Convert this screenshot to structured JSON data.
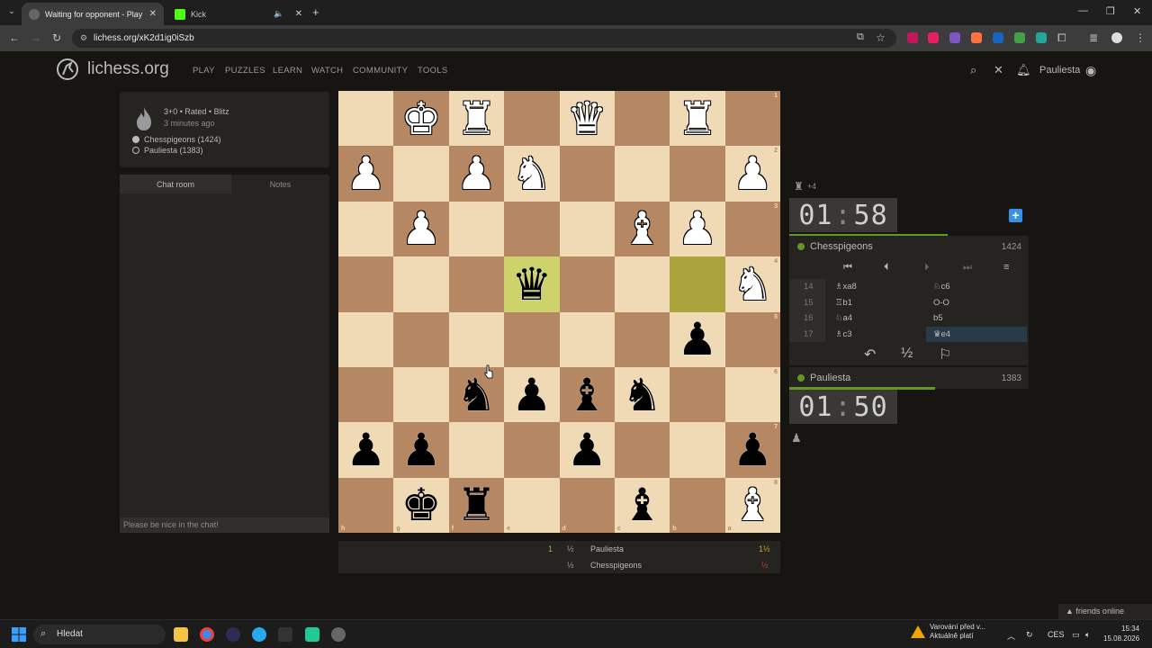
{
  "browser": {
    "tabs": [
      {
        "title": "Waiting for opponent - Play Ch",
        "close": "✕"
      },
      {
        "title": "Kick",
        "close": "✕"
      }
    ],
    "url": "lichess.org/xK2d1ig0iSzb"
  },
  "header": {
    "logo": "lichess.org",
    "nav": [
      "PLAY",
      "PUZZLES",
      "LEARN",
      "WATCH",
      "COMMUNITY",
      "TOOLS"
    ],
    "username": "Pauliesta"
  },
  "game_info": {
    "setup": "3+0 • Rated • Blitz",
    "time_ago": "3 minutes ago",
    "players": [
      "Chesspigeons (1424)",
      "Pauliesta (1383)"
    ]
  },
  "chat": {
    "tabs": [
      "Chat room",
      "Notes"
    ],
    "placeholder": "Please be nice in the chat!"
  },
  "board": {
    "orientation": "black",
    "ranks_top_to_bottom": [
      "1",
      "2",
      "3",
      "4",
      "5",
      "6",
      "7",
      "8"
    ],
    "files_left_to_right": [
      "h",
      "g",
      "f",
      "e",
      "d",
      "c",
      "b",
      "a"
    ],
    "last_move_squares": [
      "e4",
      "b4"
    ],
    "pieces": [
      {
        "sq": "g1",
        "p": "♚",
        "c": "w"
      },
      {
        "sq": "f1",
        "p": "♜",
        "c": "w"
      },
      {
        "sq": "d1",
        "p": "♛",
        "c": "w"
      },
      {
        "sq": "b1",
        "p": "♜",
        "c": "w"
      },
      {
        "sq": "h2",
        "p": "♟",
        "c": "w"
      },
      {
        "sq": "f2",
        "p": "♟",
        "c": "w"
      },
      {
        "sq": "e2",
        "p": "♞",
        "c": "w"
      },
      {
        "sq": "a2",
        "p": "♟",
        "c": "w"
      },
      {
        "sq": "g3",
        "p": "♟",
        "c": "w"
      },
      {
        "sq": "c3",
        "p": "♝",
        "c": "w"
      },
      {
        "sq": "b3",
        "p": "♟",
        "c": "w"
      },
      {
        "sq": "e4",
        "p": "♛",
        "c": "b"
      },
      {
        "sq": "a4",
        "p": "♞",
        "c": "w"
      },
      {
        "sq": "b5",
        "p": "♟",
        "c": "b"
      },
      {
        "sq": "f6",
        "p": "♞",
        "c": "b"
      },
      {
        "sq": "e6",
        "p": "♟",
        "c": "b"
      },
      {
        "sq": "d6",
        "p": "♝",
        "c": "b"
      },
      {
        "sq": "c6",
        "p": "♞",
        "c": "b"
      },
      {
        "sq": "h7",
        "p": "♟",
        "c": "b"
      },
      {
        "sq": "g7",
        "p": "♟",
        "c": "b"
      },
      {
        "sq": "d7",
        "p": "♟",
        "c": "b"
      },
      {
        "sq": "a7",
        "p": "♟",
        "c": "b"
      },
      {
        "sq": "g8",
        "p": "♚",
        "c": "b"
      },
      {
        "sq": "f8",
        "p": "♜",
        "c": "b"
      },
      {
        "sq": "c8",
        "p": "♝",
        "c": "b"
      },
      {
        "sq": "a8",
        "p": "♝",
        "c": "w"
      }
    ]
  },
  "scores": {
    "rows": [
      {
        "game": "1",
        "half": "½",
        "name": "Pauliesta",
        "score": "1½"
      },
      {
        "game": "",
        "half": "½",
        "name": "Chesspigeons",
        "score": "½"
      }
    ]
  },
  "right_panel": {
    "captured": "+4",
    "top_clock": {
      "min": "01",
      "sec": "58",
      "remaining_fraction": 0.66
    },
    "top_player": {
      "name": "Chesspigeons",
      "rating": "1424"
    },
    "moves": [
      {
        "n": "14",
        "w": "♗xa8",
        "b": "♘c6"
      },
      {
        "n": "15",
        "w": "♖b1",
        "b": "O-O"
      },
      {
        "n": "16",
        "w": "♘a4",
        "b": "b5"
      },
      {
        "n": "17",
        "w": "♗c3",
        "b": "♛e4"
      }
    ],
    "bottom_player": {
      "name": "Pauliesta",
      "rating": "1383"
    },
    "bottom_clock": {
      "min": "01",
      "sec": "50",
      "remaining_fraction": 0.61
    }
  },
  "footer": {
    "friends": "friends online"
  },
  "taskbar": {
    "search": "Hledat",
    "warning_title": "Varování před v...",
    "warning_sub": "Aktuálně platí",
    "lang": "CES",
    "time": "15:34",
    "date": "15.08.2026"
  },
  "colors": {
    "accent_green": "#629924",
    "board_light": "#f0d9b5",
    "board_dark": "#b58863",
    "highlight": "#cdd26a"
  }
}
